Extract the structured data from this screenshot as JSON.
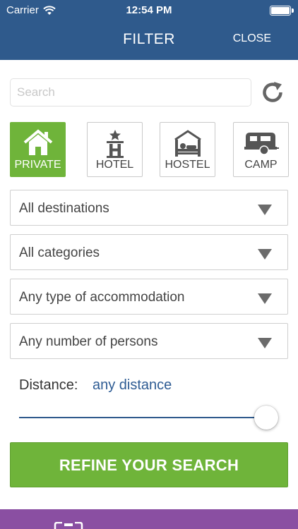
{
  "status_bar": {
    "carrier": "Carrier",
    "time": "12:54 PM"
  },
  "header": {
    "title": "FILTER",
    "close_label": "CLOSE",
    "background": "#2f5a8c"
  },
  "search": {
    "placeholder": "Search",
    "value": ""
  },
  "accommodation_types": [
    {
      "label": "PRIVATE",
      "icon": "house-icon",
      "selected": true
    },
    {
      "label": "HOTEL",
      "icon": "hotel-icon",
      "selected": false
    },
    {
      "label": "HOSTEL",
      "icon": "bed-icon",
      "selected": false
    },
    {
      "label": "CAMP",
      "icon": "caravan-icon",
      "selected": false
    }
  ],
  "filters": {
    "destinations": "All destinations",
    "categories": "All categories",
    "accommodation_type": "Any type of accommodation",
    "persons": "Any number of persons"
  },
  "distance": {
    "label": "Distance:",
    "value": "any distance",
    "slider_fraction": 1.0
  },
  "refine_button": {
    "label": "REFINE YOUR SEARCH"
  },
  "colors": {
    "accent_green": "#6fb43a",
    "header_blue": "#2f5a8c",
    "footer_purple": "#8a4fa2",
    "link_blue": "#2d5b93"
  }
}
